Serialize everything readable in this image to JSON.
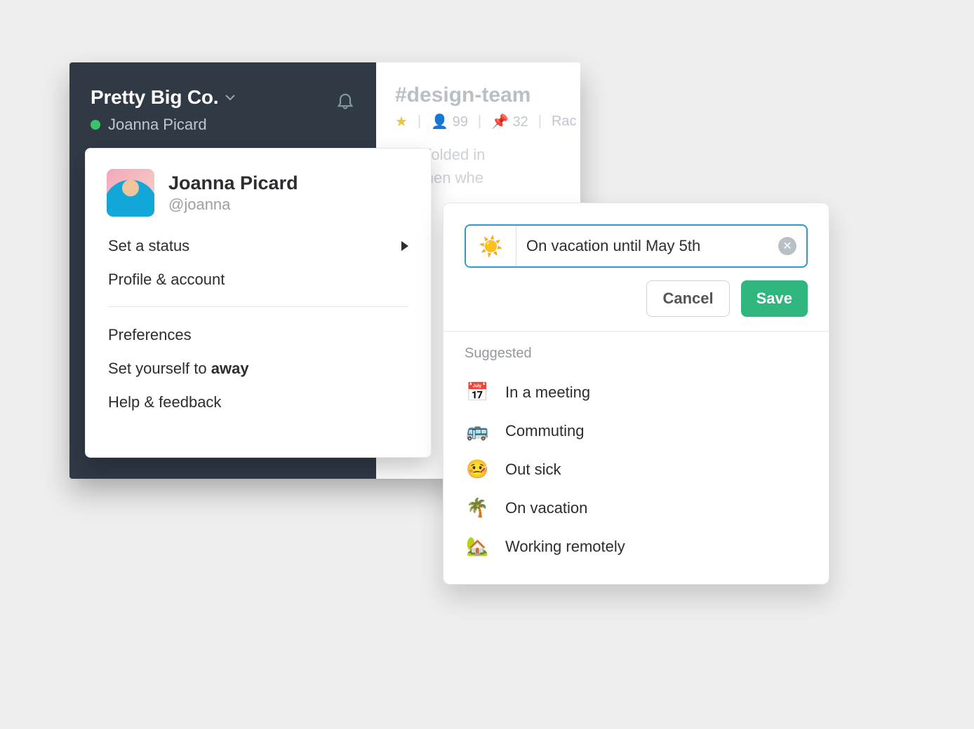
{
  "sidebar": {
    "workspace_name": "Pretty Big Co.",
    "user_name": "Joanna Picard"
  },
  "main": {
    "channel_name": "#design-team",
    "members_count": "99",
    "pins_count": "32",
    "topic_fragment": "Rac",
    "message_line1": "was folded in",
    "message_line2": "but then whe"
  },
  "user_menu": {
    "name": "Joanna Picard",
    "handle": "@joanna",
    "items": {
      "set_status": "Set a status",
      "profile_account": "Profile & account",
      "preferences": "Preferences",
      "set_away_prefix": "Set yourself to ",
      "set_away_bold": "away",
      "help_feedback": "Help & feedback"
    }
  },
  "status": {
    "emoji": "☀️",
    "text": "On vacation until May 5th",
    "cancel_label": "Cancel",
    "save_label": "Save",
    "suggested_title": "Suggested",
    "suggestions": [
      {
        "emoji": "📅",
        "label": "In a meeting"
      },
      {
        "emoji": "🚌",
        "label": "Commuting"
      },
      {
        "emoji": "🤒",
        "label": "Out sick"
      },
      {
        "emoji": "🌴",
        "label": "On vacation"
      },
      {
        "emoji": "🏡",
        "label": "Working remotely"
      }
    ]
  }
}
